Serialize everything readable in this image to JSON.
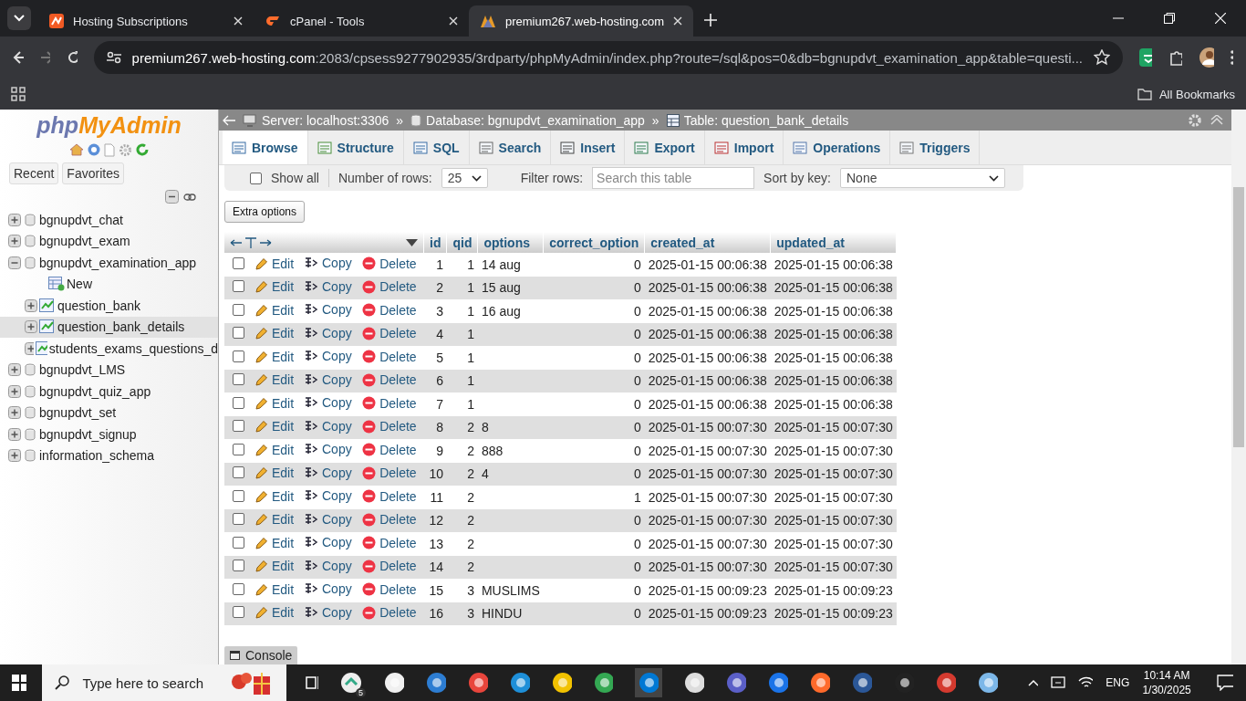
{
  "browser": {
    "tabs": [
      {
        "title": "Hosting Subscriptions",
        "kind": "hosting",
        "selected": false
      },
      {
        "title": "cPanel - Tools",
        "kind": "cpanel",
        "selected": false
      },
      {
        "title": "premium267.web-hosting.com",
        "kind": "pma",
        "selected": true
      }
    ],
    "address": {
      "host": "premium267.web-hosting.com",
      "rest": ":2083/cpsess9277902935/3rdparty/phpMyAdmin/index.php?route=/sql&pos=0&db=bgnupdvt_examination_app&table=questi..."
    },
    "bookmarks": "All Bookmarks"
  },
  "sidebar": {
    "logo": {
      "php": "php",
      "myadmin": "MyAdmin"
    },
    "buttons": [
      "Recent",
      "Favorites"
    ],
    "tree": [
      {
        "label": "bgnupdvt_chat",
        "kind": "db",
        "expanded": false,
        "selected": false
      },
      {
        "label": "bgnupdvt_exam",
        "kind": "db",
        "expanded": false,
        "selected": false
      },
      {
        "label": "bgnupdvt_examination_app",
        "kind": "db",
        "expanded": true,
        "selected": false,
        "children": [
          {
            "label": "New",
            "kind": "new",
            "selected": false
          },
          {
            "label": "question_bank",
            "kind": "table",
            "expanded": false,
            "selected": false
          },
          {
            "label": "question_bank_details",
            "kind": "table",
            "expanded": false,
            "selected": true
          },
          {
            "label": "students_exams_questions_d",
            "kind": "table",
            "expanded": false,
            "selected": false
          }
        ]
      },
      {
        "label": "bgnupdvt_LMS",
        "kind": "db",
        "expanded": false,
        "selected": false
      },
      {
        "label": "bgnupdvt_quiz_app",
        "kind": "db",
        "expanded": false,
        "selected": false
      },
      {
        "label": "bgnupdvt_set",
        "kind": "db",
        "expanded": false,
        "selected": false
      },
      {
        "label": "bgnupdvt_signup",
        "kind": "db",
        "expanded": false,
        "selected": false
      },
      {
        "label": "information_schema",
        "kind": "db",
        "expanded": false,
        "selected": false
      }
    ]
  },
  "breadcrumb": [
    {
      "label": "Server: localhost:3306",
      "kind": "server"
    },
    {
      "label": "»",
      "kind": "sep"
    },
    {
      "label": "Database: bgnupdvt_examination_app",
      "kind": "database"
    },
    {
      "label": "»",
      "kind": "sep"
    },
    {
      "label": "Table: question_bank_details",
      "kind": "table"
    }
  ],
  "nav_tabs": [
    {
      "label": "Browse",
      "kind": "browse",
      "selected": true
    },
    {
      "label": "Structure",
      "kind": "structure",
      "selected": false
    },
    {
      "label": "SQL",
      "kind": "sql",
      "selected": false
    },
    {
      "label": "Search",
      "kind": "search",
      "selected": false
    },
    {
      "label": "Insert",
      "kind": "insert",
      "selected": false
    },
    {
      "label": "Export",
      "kind": "export",
      "selected": false
    },
    {
      "label": "Import",
      "kind": "import",
      "selected": false
    },
    {
      "label": "Operations",
      "kind": "operations",
      "selected": false
    },
    {
      "label": "Triggers",
      "kind": "triggers",
      "selected": false
    }
  ],
  "filters": {
    "show_all": {
      "label": "Show all",
      "checked": false
    },
    "rows_label": "Number of rows:",
    "rows_value": "25",
    "filter_label": "Filter rows:",
    "filter_placeholder": "Search this table",
    "sort_label": "Sort by key:",
    "sort_value": "None"
  },
  "extra_options": "Extra options",
  "table": {
    "columns": [
      "id",
      "qid",
      "options",
      "correct_option",
      "created_at",
      "updated_at"
    ],
    "rows": [
      {
        "checked": false,
        "actions": [
          "Edit",
          "Copy",
          "Delete"
        ],
        "id": "1",
        "qid": "1",
        "options": "14 aug",
        "correct_option": "0",
        "created_at": "2025-01-15 00:06:38",
        "updated_at": "2025-01-15 00:06:38"
      },
      {
        "checked": false,
        "actions": [
          "Edit",
          "Copy",
          "Delete"
        ],
        "id": "2",
        "qid": "1",
        "options": "15 aug",
        "correct_option": "0",
        "created_at": "2025-01-15 00:06:38",
        "updated_at": "2025-01-15 00:06:38"
      },
      {
        "checked": false,
        "actions": [
          "Edit",
          "Copy",
          "Delete"
        ],
        "id": "3",
        "qid": "1",
        "options": "16 aug",
        "correct_option": "0",
        "created_at": "2025-01-15 00:06:38",
        "updated_at": "2025-01-15 00:06:38"
      },
      {
        "checked": false,
        "actions": [
          "Edit",
          "Copy",
          "Delete"
        ],
        "id": "4",
        "qid": "1",
        "correct_option": "0",
        "created_at": "2025-01-15 00:06:38",
        "updated_at": "2025-01-15 00:06:38"
      },
      {
        "checked": false,
        "actions": [
          "Edit",
          "Copy",
          "Delete"
        ],
        "id": "5",
        "qid": "1",
        "correct_option": "0",
        "created_at": "2025-01-15 00:06:38",
        "updated_at": "2025-01-15 00:06:38"
      },
      {
        "checked": false,
        "actions": [
          "Edit",
          "Copy",
          "Delete"
        ],
        "id": "6",
        "qid": "1",
        "correct_option": "0",
        "created_at": "2025-01-15 00:06:38",
        "updated_at": "2025-01-15 00:06:38"
      },
      {
        "checked": false,
        "actions": [
          "Edit",
          "Copy",
          "Delete"
        ],
        "id": "7",
        "qid": "1",
        "correct_option": "0",
        "created_at": "2025-01-15 00:06:38",
        "updated_at": "2025-01-15 00:06:38"
      },
      {
        "checked": false,
        "actions": [
          "Edit",
          "Copy",
          "Delete"
        ],
        "id": "8",
        "qid": "2",
        "options": "8",
        "correct_option": "0",
        "created_at": "2025-01-15 00:07:30",
        "updated_at": "2025-01-15 00:07:30"
      },
      {
        "checked": false,
        "actions": [
          "Edit",
          "Copy",
          "Delete"
        ],
        "id": "9",
        "qid": "2",
        "options": "888",
        "correct_option": "0",
        "created_at": "2025-01-15 00:07:30",
        "updated_at": "2025-01-15 00:07:30"
      },
      {
        "checked": false,
        "actions": [
          "Edit",
          "Copy",
          "Delete"
        ],
        "id": "10",
        "qid": "2",
        "options": "4",
        "correct_option": "0",
        "created_at": "2025-01-15 00:07:30",
        "updated_at": "2025-01-15 00:07:30"
      },
      {
        "checked": false,
        "actions": [
          "Edit",
          "Copy",
          "Delete"
        ],
        "id": "11",
        "qid": "2",
        "correct_option": "1",
        "created_at": "2025-01-15 00:07:30",
        "updated_at": "2025-01-15 00:07:30"
      },
      {
        "checked": false,
        "actions": [
          "Edit",
          "Copy",
          "Delete"
        ],
        "id": "12",
        "qid": "2",
        "correct_option": "0",
        "created_at": "2025-01-15 00:07:30",
        "updated_at": "2025-01-15 00:07:30"
      },
      {
        "checked": false,
        "actions": [
          "Edit",
          "Copy",
          "Delete"
        ],
        "id": "13",
        "qid": "2",
        "correct_option": "0",
        "created_at": "2025-01-15 00:07:30",
        "updated_at": "2025-01-15 00:07:30"
      },
      {
        "checked": false,
        "actions": [
          "Edit",
          "Copy",
          "Delete"
        ],
        "id": "14",
        "qid": "2",
        "correct_option": "0",
        "created_at": "2025-01-15 00:07:30",
        "updated_at": "2025-01-15 00:07:30"
      },
      {
        "checked": false,
        "actions": [
          "Edit",
          "Copy",
          "Delete"
        ],
        "id": "15",
        "qid": "3",
        "options": "MUSLIMS",
        "correct_option": "0",
        "created_at": "2025-01-15 00:09:23",
        "updated_at": "2025-01-15 00:09:23"
      },
      {
        "checked": false,
        "actions": [
          "Edit",
          "Copy",
          "Delete"
        ],
        "id": "16",
        "qid": "3",
        "options": "HINDU",
        "correct_option": "0",
        "created_at": "2025-01-15 00:09:23",
        "updated_at": "2025-01-15 00:09:23"
      }
    ]
  },
  "console": "Console",
  "taskbar": {
    "search_placeholder": "Type here to search",
    "badge": "5",
    "lang": "ENG",
    "time": "10:14 AM",
    "date": "1/30/2025"
  }
}
